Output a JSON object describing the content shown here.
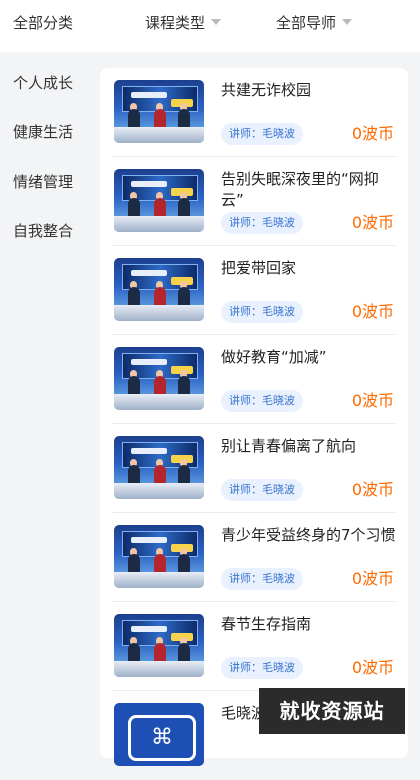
{
  "filters": {
    "all_categories": "全部分类",
    "course_type": "课程类型",
    "all_mentors": "全部导师"
  },
  "sidebar": {
    "items": [
      {
        "label": "个人成长"
      },
      {
        "label": "健康生活"
      },
      {
        "label": "情绪管理"
      },
      {
        "label": "自我整合"
      }
    ]
  },
  "courses": [
    {
      "title": "共建无诈校园",
      "lecturer": "讲师：毛晓波",
      "price": "0波币",
      "thumb": "studio"
    },
    {
      "title": "告别失眠深夜里的“网抑云”",
      "lecturer": "讲师：毛晓波",
      "price": "0波币",
      "thumb": "studio"
    },
    {
      "title": "把爱带回家",
      "lecturer": "讲师：毛晓波",
      "price": "0波币",
      "thumb": "studio"
    },
    {
      "title": "做好教育“加减”",
      "lecturer": "讲师：毛晓波",
      "price": "0波币",
      "thumb": "studio"
    },
    {
      "title": "别让青春偏离了航向",
      "lecturer": "讲师：毛晓波",
      "price": "0波币",
      "thumb": "studio"
    },
    {
      "title": "青少年受益终身的7个习惯",
      "lecturer": "讲师：毛晓波",
      "price": "0波币",
      "thumb": "studio"
    },
    {
      "title": "春节生存指南",
      "lecturer": "讲师：毛晓波",
      "price": "0波币",
      "thumb": "studio"
    },
    {
      "title": "毛晓波",
      "lecturer": "",
      "price": "",
      "thumb": "logo"
    }
  ],
  "watermark": "就收资源站",
  "colors": {
    "accent": "#ff6a00",
    "tag_text": "#3a74cf",
    "tag_bg": "#e8f1fd"
  }
}
